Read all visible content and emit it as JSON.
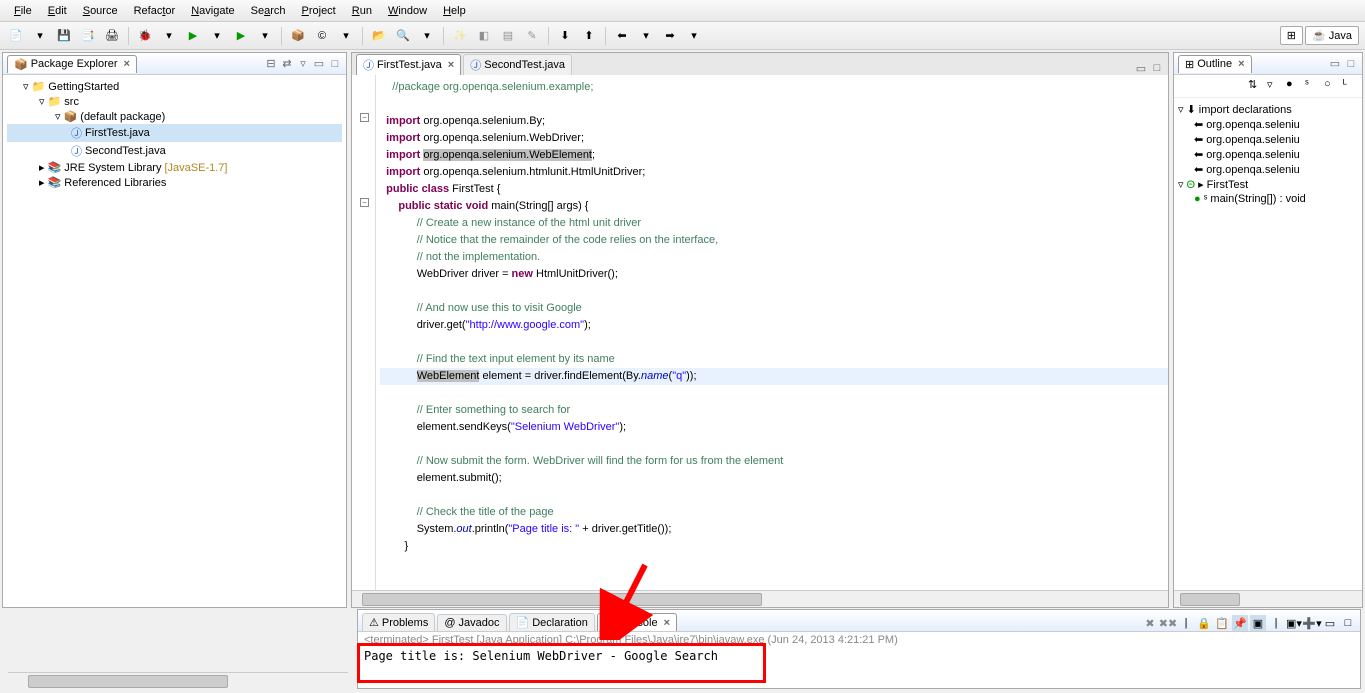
{
  "menu": {
    "file": "File",
    "edit": "Edit",
    "source": "Source",
    "refactor": "Refactor",
    "navigate": "Navigate",
    "search": "Search",
    "project": "Project",
    "run": "Run",
    "window": "Window",
    "help": "Help"
  },
  "perspective": {
    "java": "Java"
  },
  "pkg_explorer": {
    "title": "Package Explorer",
    "project": "GettingStarted",
    "src": "src",
    "default_pkg": "(default package)",
    "file1": "FirstTest.java",
    "file2": "SecondTest.java",
    "jre": "JRE System Library",
    "jre_ver": "[JavaSE-1.7]",
    "ref_libs": "Referenced Libraries"
  },
  "editor": {
    "tab1": "FirstTest.java",
    "tab2": "SecondTest.java"
  },
  "code": {
    "l1": "//package org.openqa.selenium.example;",
    "l3a": "import",
    "l3b": " org.openqa.selenium.By;",
    "l4a": "import",
    "l4b": " org.openqa.selenium.WebDriver;",
    "l5a": "import",
    "l5b": " org.openqa.selenium.WebElement;",
    "l5sel": "org.openqa.selenium.WebElement",
    "l6a": "import",
    "l6b": " org.openqa.selenium.htmlunit.HtmlUnitDriver;",
    "l7a": "public class",
    "l7b": " FirstTest {",
    "l8a": "public static void",
    "l8b": " main(String[] args) {",
    "l9": "// Create a new instance of the html unit driver",
    "l10": "// Notice that the remainder of the code relies on the interface,",
    "l11": "// not the implementation.",
    "l12a": "WebDriver driver = ",
    "l12b": "new",
    "l12c": " HtmlUnitDriver();",
    "l14": "// And now use this to visit Google",
    "l15a": "driver.get(",
    "l15b": "\"http://www.google.com\"",
    "l15c": ");",
    "l17": "// Find the text input element by its name",
    "l18a": "WebElement",
    "l18b": " element = driver.findElement(By.",
    "l18c": "name",
    "l18d": "(",
    "l18e": "\"q\"",
    "l18f": "));",
    "l20": "// Enter something to search for",
    "l21a": "element.sendKeys(",
    "l21b": "\"Selenium WebDriver\"",
    "l21c": ");",
    "l23": "// Now submit the form. WebDriver will find the form for us from the element",
    "l24": "element.submit();",
    "l26": "// Check the title of the page",
    "l27a": "System.",
    "l27b": "out",
    "l27c": ".println(",
    "l27d": "\"Page title is: \"",
    "l27e": " + driver.getTitle());",
    "l28": "}"
  },
  "outline": {
    "title": "Outline",
    "imports": "import declarations",
    "i1": "org.openqa.seleniu",
    "i2": "org.openqa.seleniu",
    "i3": "org.openqa.seleniu",
    "i4": "org.openqa.seleniu",
    "class": "FirstTest",
    "method": "main(String[]) : void"
  },
  "bottom": {
    "problems": "Problems",
    "javadoc": "Javadoc",
    "declaration": "Declaration",
    "console": "Console",
    "term": "<terminated> FirstTest [Java Application] C:\\Program Files\\Java\\jre7\\bin\\javaw.exe (Jun 24, 2013 4:21:21 PM)",
    "output": "Page title is: Selenium WebDriver - Google Search"
  }
}
